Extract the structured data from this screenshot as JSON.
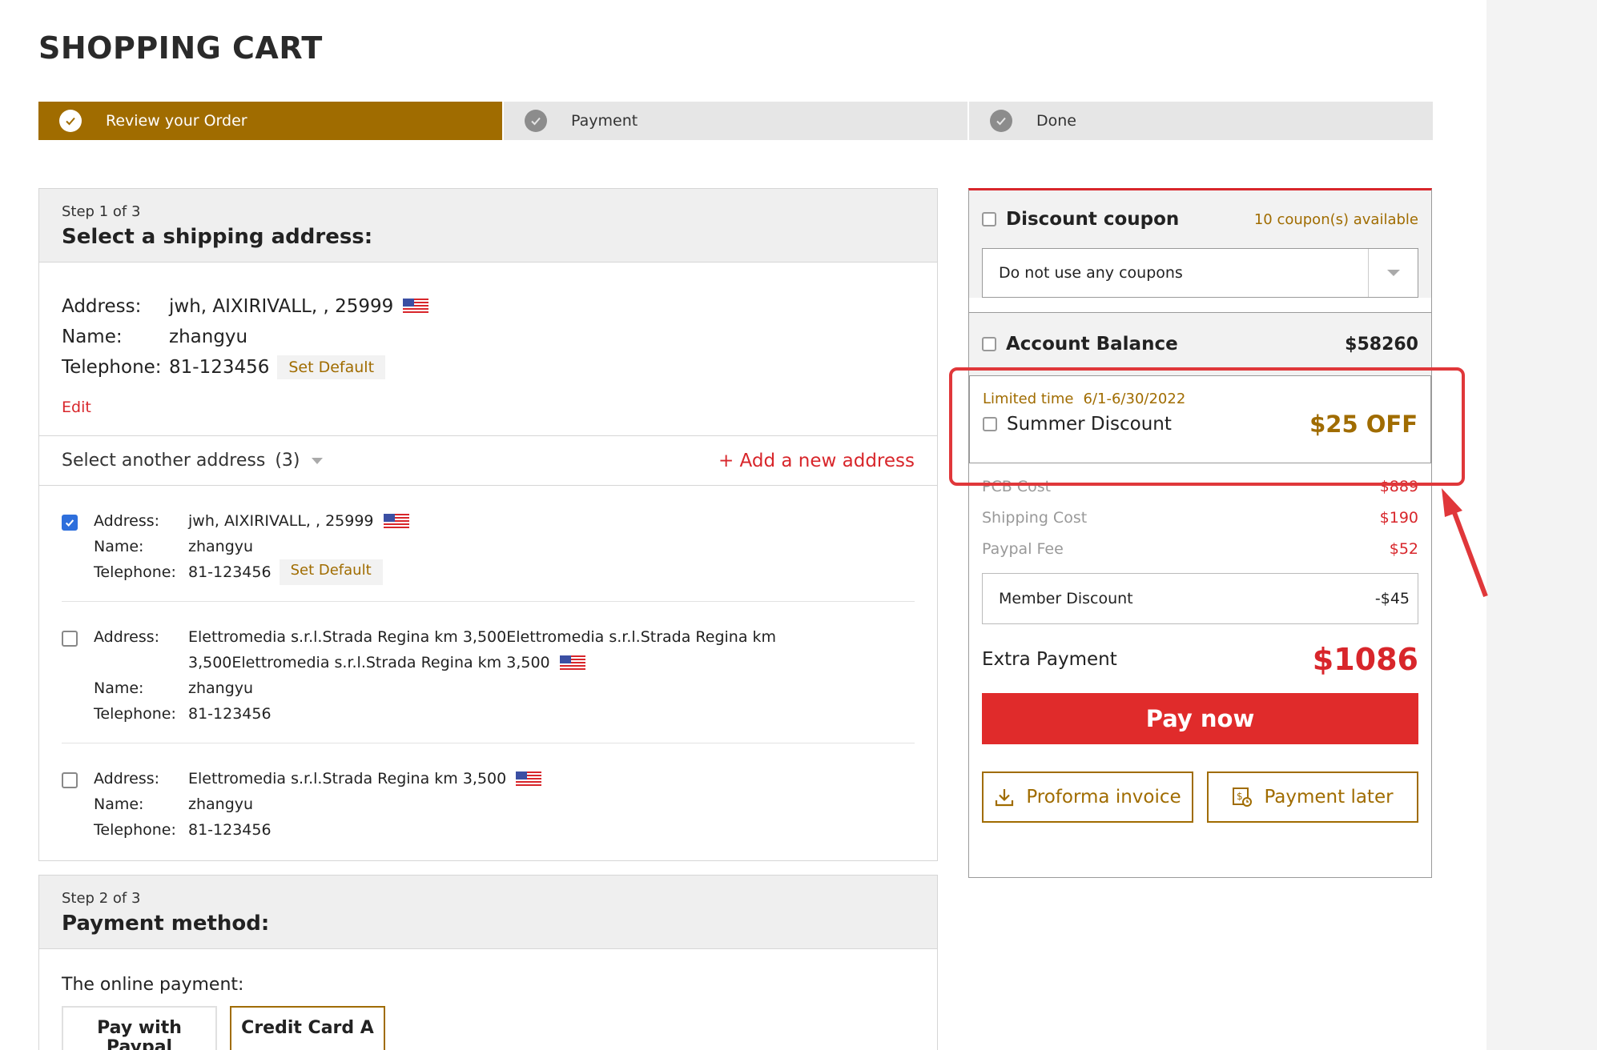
{
  "page": {
    "title": "SHOPPING CART"
  },
  "steps": [
    {
      "label": "Review your Order",
      "active": true
    },
    {
      "label": "Payment",
      "active": false
    },
    {
      "label": "Done",
      "active": false
    }
  ],
  "shipping": {
    "step_label": "Step 1 of 3",
    "title": "Select a shipping address:",
    "current": {
      "address_label": "Address:",
      "address": "jwh, AIXIRIVALL, , 25999",
      "name_label": "Name:",
      "name": "zhangyu",
      "phone_label": "Telephone:",
      "phone": "81-123456",
      "set_default": "Set Default",
      "edit": "Edit"
    },
    "another": {
      "label": "Select another address",
      "count": "(3)",
      "add": "+ Add a new address"
    },
    "list": [
      {
        "checked": true,
        "address_label": "Address:",
        "address": "jwh, AIXIRIVALL, , 25999",
        "name_label": "Name:",
        "name": "zhangyu",
        "phone_label": "Telephone:",
        "phone": "81-123456",
        "set_default": "Set Default"
      },
      {
        "checked": false,
        "address_label": "Address:",
        "address": "Elettromedia s.r.l.Strada Regina km 3,500Elettromedia s.r.l.Strada Regina km 3,500Elettromedia s.r.l.Strada Regina km 3,500",
        "name_label": "Name:",
        "name": "zhangyu",
        "phone_label": "Telephone:",
        "phone": "81-123456"
      },
      {
        "checked": false,
        "address_label": "Address:",
        "address": "Elettromedia s.r.l.Strada Regina km 3,500",
        "name_label": "Name:",
        "name": "zhangyu",
        "phone_label": "Telephone:",
        "phone": "81-123456"
      }
    ]
  },
  "payment_method": {
    "step_label": "Step 2 of 3",
    "title": "Payment method:",
    "online_label": "The online payment:",
    "options": [
      "Pay with Paypal",
      "Credit Card A"
    ],
    "selected": "Credit Card A"
  },
  "summary": {
    "coupon": {
      "title": "Discount coupon",
      "available": "10  coupon(s) available",
      "selected": "Do not use any coupons"
    },
    "balance": {
      "title": "Account Balance",
      "value": "$58260"
    },
    "promo": {
      "limited": "Limited time",
      "dates": "6/1-6/30/2022",
      "name": "Summer Discount",
      "off": "$25 OFF"
    },
    "costs": [
      {
        "name": "PCB Cost",
        "value": "$889"
      },
      {
        "name": "Shipping Cost",
        "value": "$190"
      },
      {
        "name": "Paypal Fee",
        "value": "$52"
      }
    ],
    "member": {
      "name": "Member Discount",
      "value": "-$45"
    },
    "extra": {
      "name": "Extra Payment",
      "value": "$1086"
    },
    "pay_now": "Pay now",
    "proforma": "Proforma invoice",
    "later": "Payment later"
  },
  "colors": {
    "accent": "#a06c00",
    "red": "#e02b2b",
    "annotation": "#e0373a"
  }
}
